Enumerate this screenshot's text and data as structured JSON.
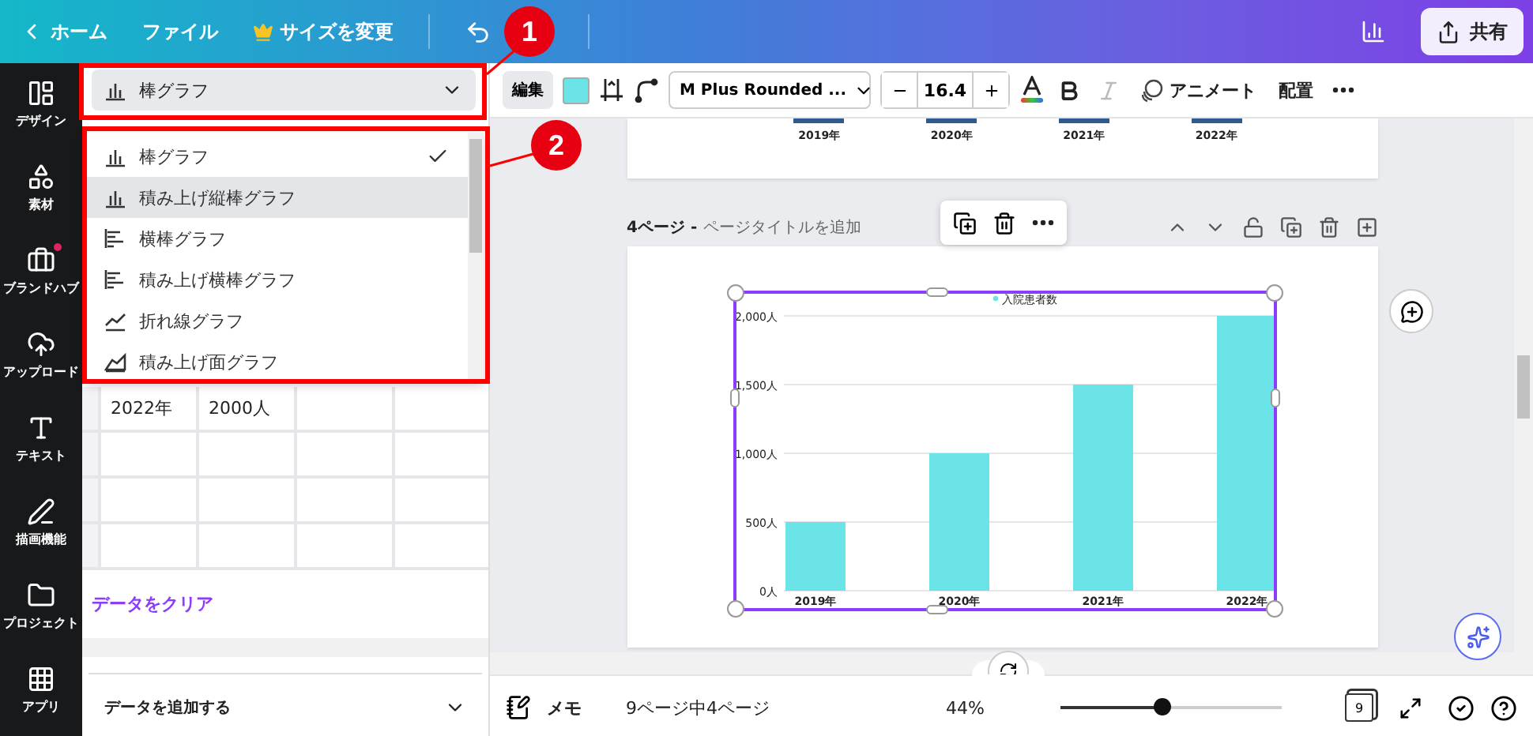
{
  "topbar": {
    "home": "ホーム",
    "file": "ファイル",
    "resize": "サイズを変更",
    "share": "共有"
  },
  "sidebar": [
    {
      "label": "デザイン",
      "notification": false
    },
    {
      "label": "素材",
      "notification": false
    },
    {
      "label": "ブランドハブ",
      "notification": true
    },
    {
      "label": "アップロード",
      "notification": false
    },
    {
      "label": "テキスト",
      "notification": false
    },
    {
      "label": "描画機能",
      "notification": false
    },
    {
      "label": "プロジェクト",
      "notification": false
    },
    {
      "label": "アプリ",
      "notification": false
    }
  ],
  "chart_panel": {
    "chart_type": "棒グラフ",
    "chart_types": [
      {
        "label": "棒グラフ",
        "kind": "bar",
        "selected": true,
        "hovered": false
      },
      {
        "label": "積み上げ縦棒グラフ",
        "kind": "bar",
        "selected": false,
        "hovered": true
      },
      {
        "label": "横棒グラフ",
        "kind": "hbar",
        "selected": false,
        "hovered": false
      },
      {
        "label": "積み上げ横棒グラフ",
        "kind": "hbar",
        "selected": false,
        "hovered": false
      },
      {
        "label": "折れ線グラフ",
        "kind": "line",
        "selected": false,
        "hovered": false
      },
      {
        "label": "積み上げ面グラフ",
        "kind": "area",
        "selected": false,
        "hovered": false
      }
    ],
    "table_rows": [
      [
        "2022年",
        "2000人"
      ]
    ],
    "clear_data": "データをクリア",
    "add_data": "データを追加する"
  },
  "toolbar": {
    "edit": "編集",
    "font": "M Plus Rounded ...",
    "font_size": "16.4",
    "italic_disabled": true,
    "animate": "アニメート",
    "arrange": "配置"
  },
  "previous_page": {
    "axis_labels": [
      "2019年",
      "2020年",
      "2021年",
      "2022年"
    ]
  },
  "page": {
    "number": "4ページ -",
    "title_placeholder": "ページタイトルを追加",
    "chart_data": {
      "type": "bar",
      "categories": [
        "2019年",
        "2020年",
        "2021年",
        "2022年"
      ],
      "series": [
        {
          "name": "入院患者数",
          "color": "#6ae4e6",
          "values": [
            500,
            1000,
            1500,
            2000
          ]
        }
      ],
      "ylim": [
        0,
        2000
      ],
      "grid": true,
      "yticks": [
        {
          "value": 0,
          "label": "0人"
        },
        {
          "value": 500,
          "label": "500人"
        },
        {
          "value": 1000,
          "label": "1,000人"
        },
        {
          "value": 1500,
          "label": "1,500人"
        },
        {
          "value": 2000,
          "label": "2,000人"
        }
      ]
    }
  },
  "bottom_bar": {
    "notes": "メモ",
    "page_indicator": "9ページ中4ページ",
    "zoom": "44%",
    "zoom_slider": {
      "level": 0.46
    },
    "page_count": "9"
  },
  "annotations": [
    {
      "number": "1"
    },
    {
      "number": "2"
    }
  ]
}
